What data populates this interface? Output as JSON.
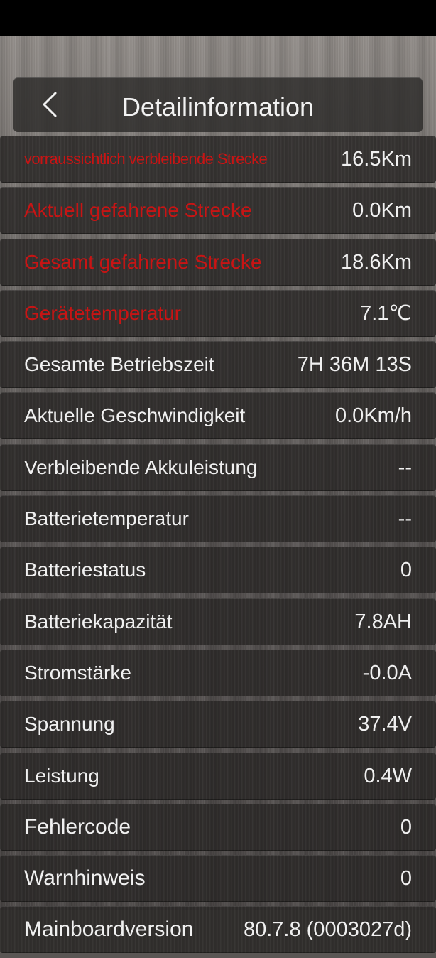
{
  "header": {
    "title": "Detailinformation"
  },
  "rows": [
    {
      "label": "vorraussichtlich verbleibende Strecke",
      "value": "16.5Km"
    },
    {
      "label": "Aktuell gefahrene Strecke",
      "value": "0.0Km"
    },
    {
      "label": "Gesamt gefahrene Strecke",
      "value": "18.6Km"
    },
    {
      "label": "Gerätetemperatur",
      "value": "7.1℃"
    },
    {
      "label": "Gesamte Betriebszeit",
      "value": "7H 36M 13S"
    },
    {
      "label": "Aktuelle Geschwindigkeit",
      "value": "0.0Km/h"
    },
    {
      "label": "Verbleibende Akkuleistung",
      "value": "--"
    },
    {
      "label": "Batterietemperatur",
      "value": "--"
    },
    {
      "label": "Batteriestatus",
      "value": "0"
    },
    {
      "label": "Batteriekapazität",
      "value": "7.8AH"
    },
    {
      "label": "Stromstärke",
      "value": "-0.0A"
    },
    {
      "label": "Spannung",
      "value": "37.4V"
    },
    {
      "label": "Leistung",
      "value": "0.4W"
    },
    {
      "label": "Fehlercode",
      "value": "0"
    },
    {
      "label": "Warnhinweis",
      "value": "0"
    },
    {
      "label": "Mainboardversion",
      "value": "80.7.8 (0003027d)"
    }
  ],
  "icons": {
    "back": "chevron-left-icon"
  },
  "colors": {
    "highlight_label": "#c81414",
    "text": "#f0f0f0"
  }
}
